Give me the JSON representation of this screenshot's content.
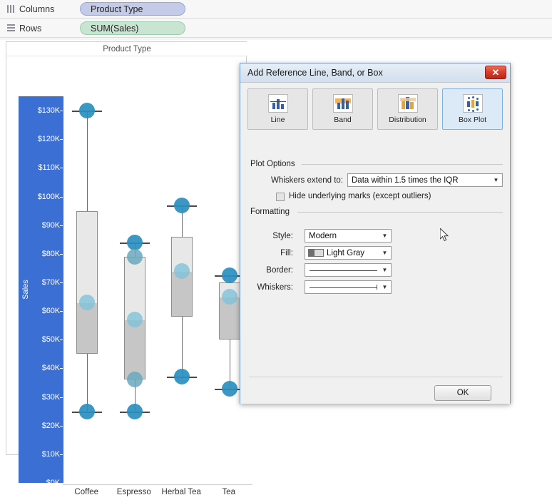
{
  "shelves": {
    "columns": {
      "label": "Columns",
      "icon": "columns-icon",
      "pill": "Product Type"
    },
    "rows": {
      "label": "Rows",
      "icon": "rows-icon",
      "pill": "SUM(Sales)"
    }
  },
  "viz": {
    "title": "Product Type",
    "axis_title": "Sales",
    "y_ticks": [
      "$130K",
      "$120K",
      "$110K",
      "$100K",
      "$90K",
      "$80K",
      "$70K",
      "$60K",
      "$50K",
      "$40K",
      "$30K",
      "$20K",
      "$10K",
      "$0K"
    ],
    "x_ticks": [
      "Coffee",
      "Espresso",
      "Herbal Tea",
      "Tea"
    ],
    "axis_highlight_color": "#3b6fd4",
    "mark_color": "#2a8fc0",
    "box_fill_color": "#e8e8e8",
    "box_lower_fill_color": "#c6c6c6"
  },
  "chart_data": {
    "type": "box",
    "title": "Product Type",
    "xlabel": "Product Type",
    "ylabel": "Sales",
    "ylim": [
      0,
      135000
    ],
    "ytick_values": [
      130000,
      120000,
      110000,
      100000,
      90000,
      80000,
      70000,
      60000,
      50000,
      40000,
      30000,
      20000,
      10000,
      0
    ],
    "ytick_labels": [
      "$130K",
      "$120K",
      "$110K",
      "$100K",
      "$90K",
      "$80K",
      "$70K",
      "$60K",
      "$50K",
      "$40K",
      "$30K",
      "$20K",
      "$10K",
      "$0K"
    ],
    "grid": false,
    "legend": "none",
    "categories": [
      "Coffee",
      "Espresso",
      "Herbal Tea",
      "Tea"
    ],
    "boxes": [
      {
        "category": "Coffee",
        "whisker_low": 25000,
        "q1": 45000,
        "median": 63000,
        "q3": 95000,
        "whisker_high": 130000
      },
      {
        "category": "Espresso",
        "whisker_low": 25000,
        "q1": 36000,
        "median": 57000,
        "q3": 79000,
        "whisker_high": 84000
      },
      {
        "category": "Herbal Tea",
        "whisker_low": 37000,
        "q1": 58000,
        "median": 74000,
        "q3": 86000,
        "whisker_high": 97000
      },
      {
        "category": "Tea",
        "whisker_low": 33000,
        "q1": 50000,
        "median": 65000,
        "q3": 70000,
        "whisker_high": 72500
      }
    ],
    "marks": [
      {
        "category": "Coffee",
        "values": [
          130000,
          63000,
          25000
        ]
      },
      {
        "category": "Espresso",
        "values": [
          84000,
          79000,
          57000,
          36000,
          25000
        ]
      },
      {
        "category": "Herbal Tea",
        "values": [
          97000,
          74000,
          37000
        ]
      },
      {
        "category": "Tea",
        "values": [
          72500,
          65000,
          33000
        ]
      }
    ]
  },
  "dialog": {
    "title": "Add Reference Line, Band, or Box",
    "close_label": "✕",
    "tabs": [
      {
        "label": "Line",
        "icon": "line-chart-icon",
        "selected": false
      },
      {
        "label": "Band",
        "icon": "band-chart-icon",
        "selected": false
      },
      {
        "label": "Distribution",
        "icon": "distribution-chart-icon",
        "selected": false
      },
      {
        "label": "Box Plot",
        "icon": "box-plot-icon",
        "selected": true
      }
    ],
    "plot_options": {
      "group_label": "Plot Options",
      "whiskers_label": "Whiskers extend to:",
      "whiskers_value": "Data within 1.5 times the IQR",
      "hide_marks_label": "Hide underlying marks (except outliers)",
      "hide_marks_checked": false
    },
    "formatting": {
      "group_label": "Formatting",
      "style_label": "Style:",
      "style_value": "Modern",
      "fill_label": "Fill:",
      "fill_value": "Light Gray",
      "border_label": "Border:",
      "border_value": "",
      "whiskers_label": "Whiskers:",
      "whiskers_value": ""
    },
    "ok_label": "OK"
  }
}
